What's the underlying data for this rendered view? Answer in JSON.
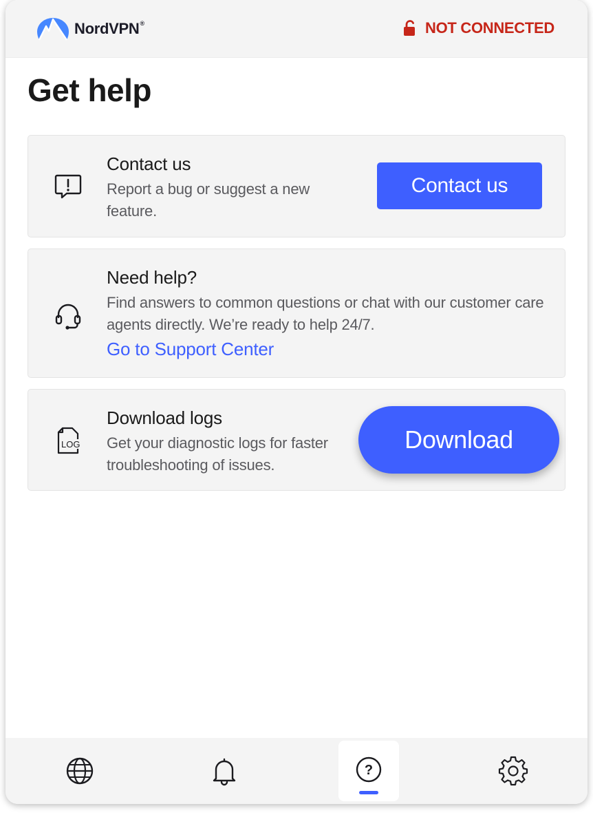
{
  "app": {
    "brand_name": "NordVPN",
    "brand_tm": "®",
    "status_text": "NOT CONNECTED",
    "status_color": "#c62619",
    "accent_color": "#3e5fff"
  },
  "page": {
    "title": "Get help"
  },
  "cards": [
    {
      "icon": "message-alert-icon",
      "title": "Contact us",
      "description": "Report a bug or suggest a new feature.",
      "button_label": "Contact us"
    },
    {
      "icon": "headset-icon",
      "title": "Need help?",
      "description": "Find answers to common questions or chat with our customer care agents directly. We’re ready to help 24/7.",
      "link_label": "Go to Support Center"
    },
    {
      "icon": "log-file-icon",
      "icon_text": "LOG",
      "title": "Download logs",
      "description": "Get your diagnostic logs for faster troubleshooting of issues.",
      "button_label": "Download"
    }
  ],
  "bottom_nav": {
    "items": [
      {
        "icon": "globe-icon",
        "active": false
      },
      {
        "icon": "bell-icon",
        "active": false
      },
      {
        "icon": "help-icon",
        "icon_text": "?",
        "active": true
      },
      {
        "icon": "gear-icon",
        "active": false
      }
    ]
  }
}
